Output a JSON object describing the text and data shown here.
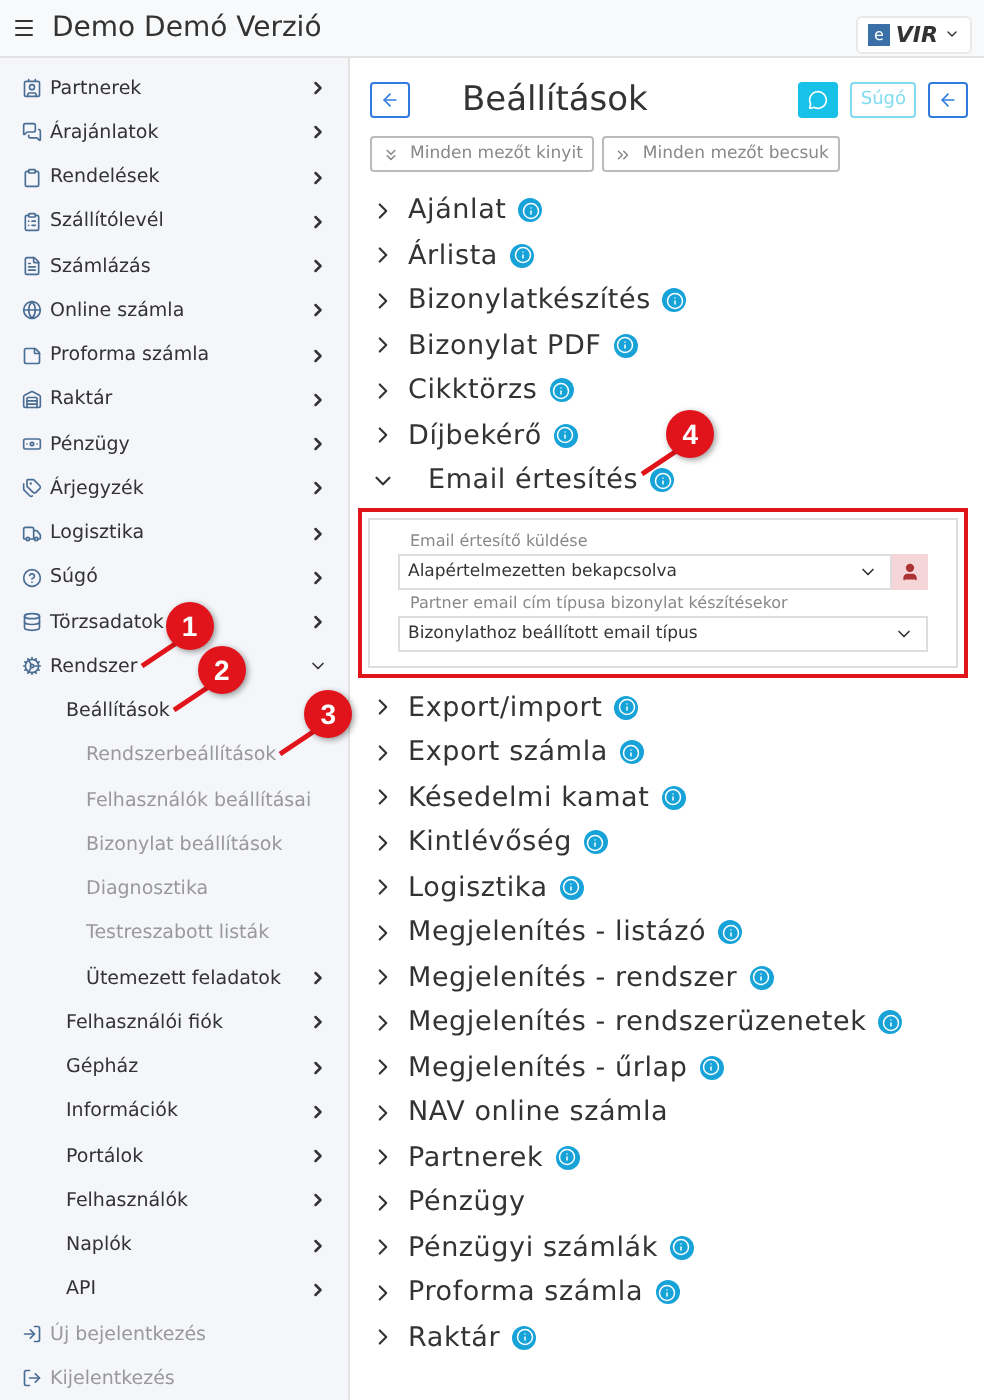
{
  "header": {
    "title": "Demo Demó Verzió",
    "logo_mark": "e",
    "logo_text": "VIR"
  },
  "sidebar": {
    "items": [
      {
        "label": "Partnerek",
        "expanded": false
      },
      {
        "label": "Árajánlatok",
        "expanded": false
      },
      {
        "label": "Rendelések",
        "expanded": false
      },
      {
        "label": "Szállítólevél",
        "expanded": false
      },
      {
        "label": "Számlázás",
        "expanded": false
      },
      {
        "label": "Online számla",
        "expanded": false
      },
      {
        "label": "Proforma számla",
        "expanded": false
      },
      {
        "label": "Raktár",
        "expanded": false
      },
      {
        "label": "Pénzügy",
        "expanded": false
      },
      {
        "label": "Árjegyzék",
        "expanded": false
      },
      {
        "label": "Logisztika",
        "expanded": false
      },
      {
        "label": "Súgó",
        "expanded": false
      },
      {
        "label": "Törzsadatok",
        "expanded": false
      },
      {
        "label": "Rendszer",
        "expanded": true,
        "callout": "1",
        "children": [
          {
            "label": "Beállítások",
            "callout": "2",
            "children": [
              {
                "label": "Rendszerbeállítások",
                "callout": "3"
              },
              {
                "label": "Felhasználók beállításai"
              },
              {
                "label": "Bizonylat beállítások"
              },
              {
                "label": "Diagnosztika"
              },
              {
                "label": "Testreszabott listák"
              },
              {
                "label": "Ütemezett feladatok",
                "expanded": false
              }
            ]
          },
          {
            "label": "Felhasználói fiók",
            "expanded": false
          },
          {
            "label": "Gépház",
            "expanded": false
          },
          {
            "label": "Információk",
            "expanded": false
          },
          {
            "label": "Portálok",
            "expanded": false
          },
          {
            "label": "Felhasználók",
            "expanded": false
          },
          {
            "label": "Naplók",
            "expanded": false
          },
          {
            "label": "API",
            "expanded": false
          }
        ]
      }
    ],
    "footer_links": [
      "Új bejelentkezés",
      "Kijelentkezés"
    ]
  },
  "page": {
    "title": "Beállítások",
    "help_button": "Súgó",
    "toolbar": [
      "Minden mezőt kinyit",
      "Minden mezőt becsuk"
    ]
  },
  "sections": [
    {
      "label": "Ajánlat",
      "expanded": false,
      "info": true
    },
    {
      "label": "Árlista",
      "expanded": false,
      "info": true
    },
    {
      "label": "Bizonylatkészítés",
      "expanded": false,
      "info": true
    },
    {
      "label": "Bizonylat PDF",
      "expanded": false,
      "info": true
    },
    {
      "label": "Cikktörzs",
      "expanded": false,
      "info": true
    },
    {
      "label": "Díjbekérő",
      "expanded": false,
      "info": true
    },
    {
      "label": "Email értesítés",
      "expanded": true,
      "info": true,
      "callout": "4",
      "highlighted": true,
      "fields": [
        {
          "label": "Email értesítő küldése",
          "value": "Alapértelmezetten bekapcsolva",
          "user_button": true
        },
        {
          "label": "Partner email cím típusa bizonylat készítésekor",
          "value": "Bizonylathoz beállított email típus",
          "user_button": false
        }
      ]
    },
    {
      "label": "Export/import",
      "expanded": false,
      "info": true
    },
    {
      "label": "Export számla",
      "expanded": false,
      "info": true
    },
    {
      "label": "Késedelmi kamat",
      "expanded": false,
      "info": true
    },
    {
      "label": "Kintlévőség",
      "expanded": false,
      "info": true
    },
    {
      "label": "Logisztika",
      "expanded": false,
      "info": true
    },
    {
      "label": "Megjelenítés - listázó",
      "expanded": false,
      "info": true
    },
    {
      "label": "Megjelenítés - rendszer",
      "expanded": false,
      "info": true
    },
    {
      "label": "Megjelenítés - rendszerüzenetek",
      "expanded": false,
      "info": true
    },
    {
      "label": "Megjelenítés - űrlap",
      "expanded": false,
      "info": true
    },
    {
      "label": "NAV online számla",
      "expanded": false,
      "info": false
    },
    {
      "label": "Partnerek",
      "expanded": false,
      "info": true
    },
    {
      "label": "Pénzügy",
      "expanded": false,
      "info": false
    },
    {
      "label": "Pénzügyi számlák",
      "expanded": false,
      "info": true
    },
    {
      "label": "Proforma számla",
      "expanded": false,
      "info": true
    },
    {
      "label": "Raktár",
      "expanded": false,
      "info": true
    }
  ]
}
